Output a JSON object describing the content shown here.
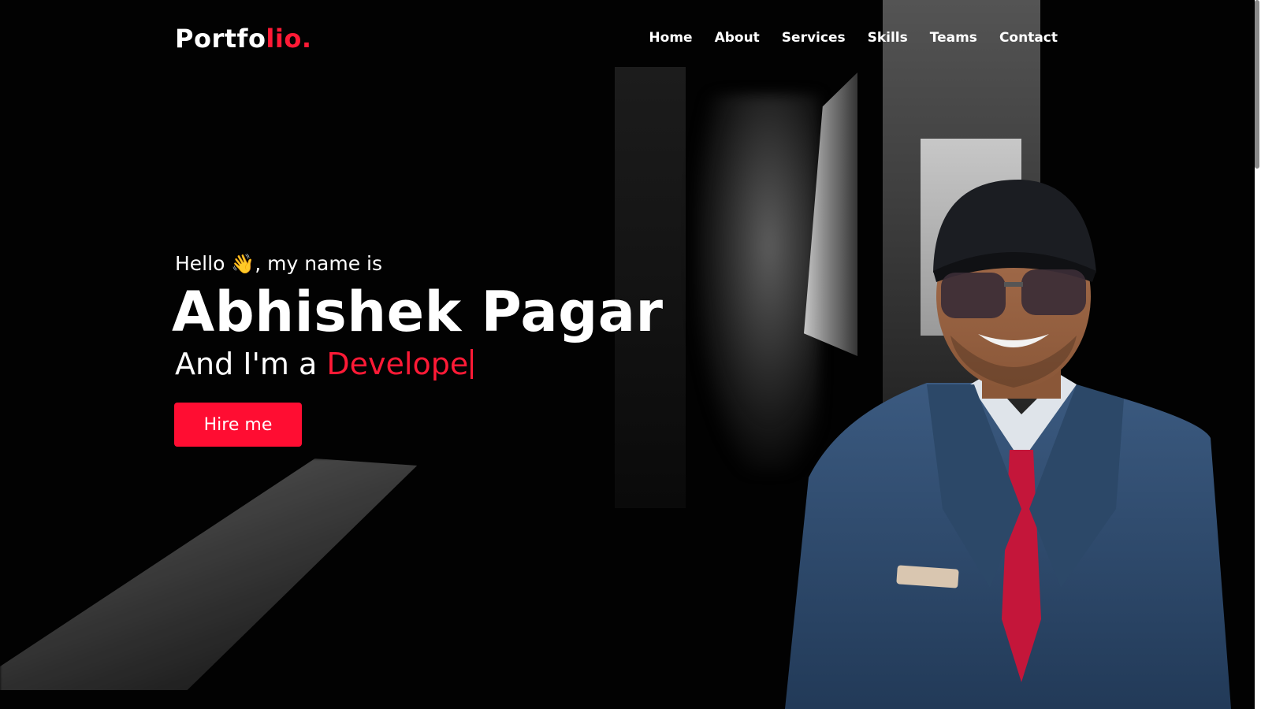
{
  "brand": {
    "logo_main": "Portfo",
    "logo_accent": "lio."
  },
  "nav": {
    "items": [
      {
        "label": "Home"
      },
      {
        "label": "About"
      },
      {
        "label": "Services"
      },
      {
        "label": "Skills"
      },
      {
        "label": "Teams"
      },
      {
        "label": "Contact"
      }
    ]
  },
  "hero": {
    "greeting_before": "Hello ",
    "wave_emoji": "👋",
    "greeting_after": ", my name is",
    "name": "Abhishek Pagar",
    "role_prefix": "And I'm a ",
    "role_typed": "Develope",
    "cta_label": "Hire me"
  },
  "colors": {
    "accent": "#ff1a36",
    "background": "#000000",
    "text": "#ffffff"
  },
  "icons": {
    "wave": "waving-hand-icon"
  }
}
